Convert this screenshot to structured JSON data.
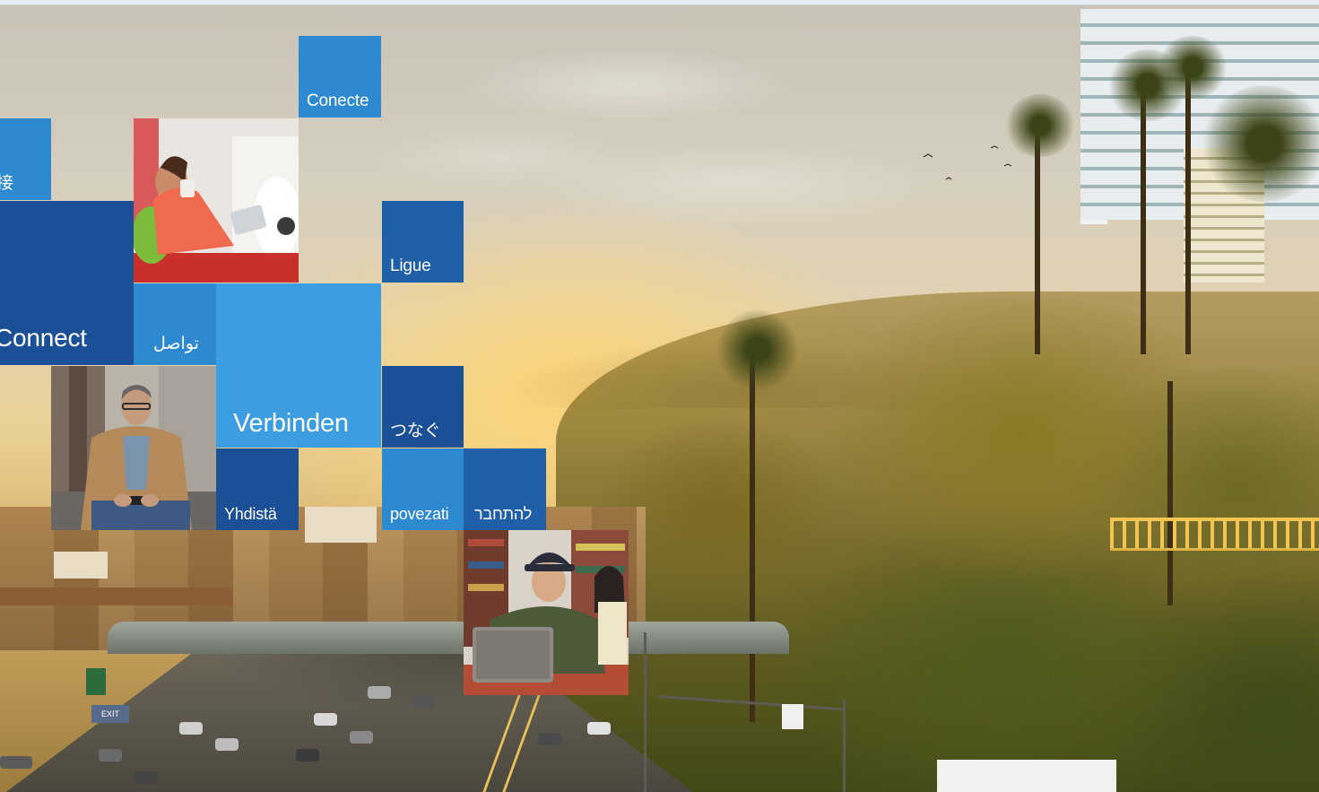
{
  "tiles": {
    "conecte": "Conecte",
    "chinese": "接",
    "connect": "Connect",
    "arabic": "تواصل",
    "ligue": "Ligue",
    "verbinden": "Verbinden",
    "japanese": "つなぐ",
    "yhdista": "Yhdistä",
    "povezati": "povezati",
    "hebrew": "להתחבר"
  },
  "scene": {
    "exit_sign": "EXIT"
  },
  "colors": {
    "tile_bright_blue": "#2d8ad1",
    "tile_medium_blue": "#1f5fa8",
    "tile_dark_blue": "#1b4f96",
    "tile_light_blue": "#3c9de0"
  }
}
